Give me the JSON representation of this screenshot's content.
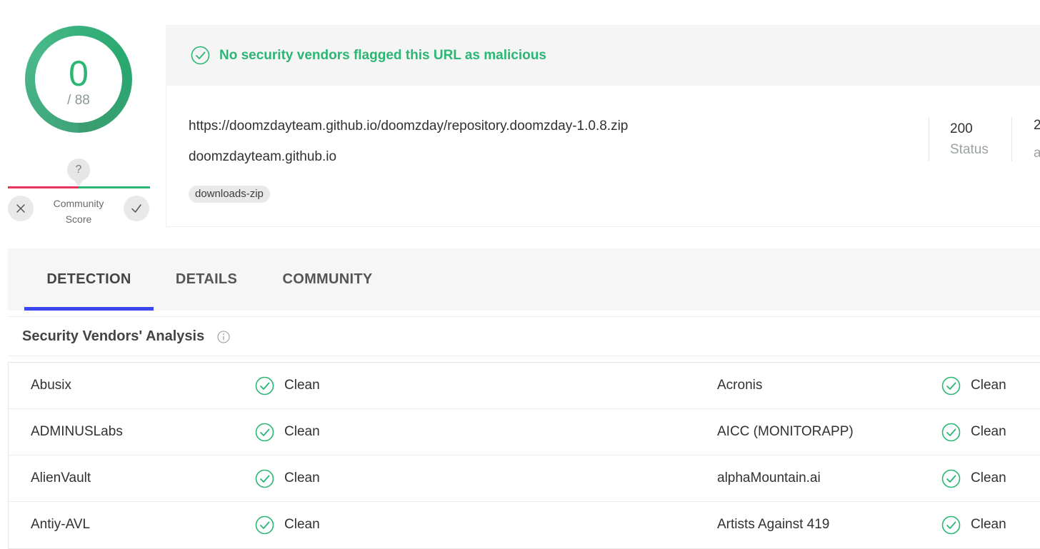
{
  "score": {
    "detections": "0",
    "total": "/ 88"
  },
  "community": {
    "bubble": "?",
    "label_line1": "Community",
    "label_line2": "Score"
  },
  "banner": {
    "message": "No security vendors flagged this URL as malicious"
  },
  "target": {
    "url": "https://doomzdayteam.github.io/doomzday/repository.doomzday-1.0.8.zip",
    "host": "doomzdayteam.github.io",
    "tag": "downloads-zip",
    "status_code": "200",
    "status_label": "Status",
    "stat2_value": "2",
    "stat2_label": "a"
  },
  "tabs": [
    {
      "label": "DETECTION",
      "active": true
    },
    {
      "label": "DETAILS",
      "active": false
    },
    {
      "label": "COMMUNITY",
      "active": false
    }
  ],
  "section": {
    "title": "Security Vendors' Analysis"
  },
  "vendors": [
    {
      "left": {
        "name": "Abusix",
        "result": "Clean"
      },
      "right": {
        "name": "Acronis",
        "result": "Clean"
      }
    },
    {
      "left": {
        "name": "ADMINUSLabs",
        "result": "Clean"
      },
      "right": {
        "name": "AICC (MONITORAPP)",
        "result": "Clean"
      }
    },
    {
      "left": {
        "name": "AlienVault",
        "result": "Clean"
      },
      "right": {
        "name": "alphaMountain.ai",
        "result": "Clean"
      }
    },
    {
      "left": {
        "name": "Antiy-AVL",
        "result": "Clean"
      },
      "right": {
        "name": "Artists Against 419",
        "result": "Clean"
      }
    }
  ],
  "colors": {
    "clean": "#2bb673",
    "malicious": "#e8345a",
    "accent": "#3b47ee"
  },
  "icons": {
    "banner": "check-circle-icon",
    "clean": "check-circle-icon",
    "info": "info-circle-icon",
    "downvote": "close-icon",
    "upvote": "check-icon"
  }
}
